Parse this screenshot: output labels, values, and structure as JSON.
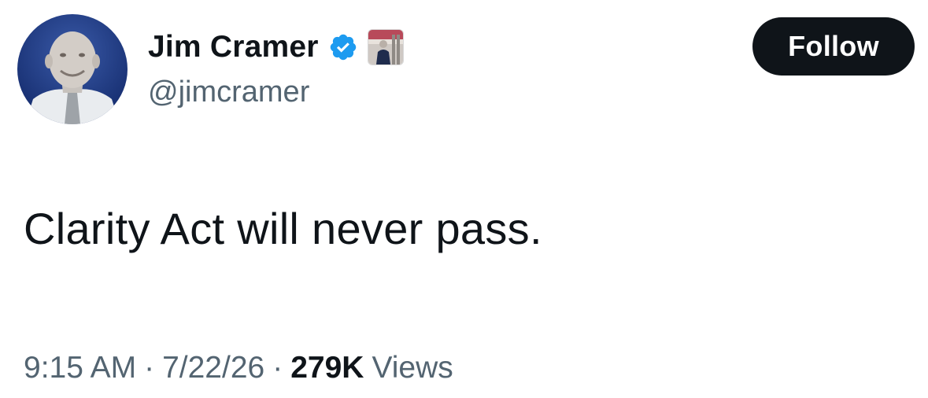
{
  "author": {
    "display_name": "Jim Cramer",
    "handle": "@jimcramer",
    "verified_icon": "verified-badge-icon",
    "verified_color": "#1d9bf0"
  },
  "actions": {
    "follow_label": "Follow"
  },
  "tweet": {
    "text": "Clarity Act will never pass."
  },
  "meta": {
    "time": "9:15 AM",
    "separator": "·",
    "date": "7/22/26",
    "views_count": "279K",
    "views_label": "Views"
  },
  "colors": {
    "text_primary": "#0f1419",
    "text_secondary": "#536471",
    "button_bg": "#0f1419"
  }
}
